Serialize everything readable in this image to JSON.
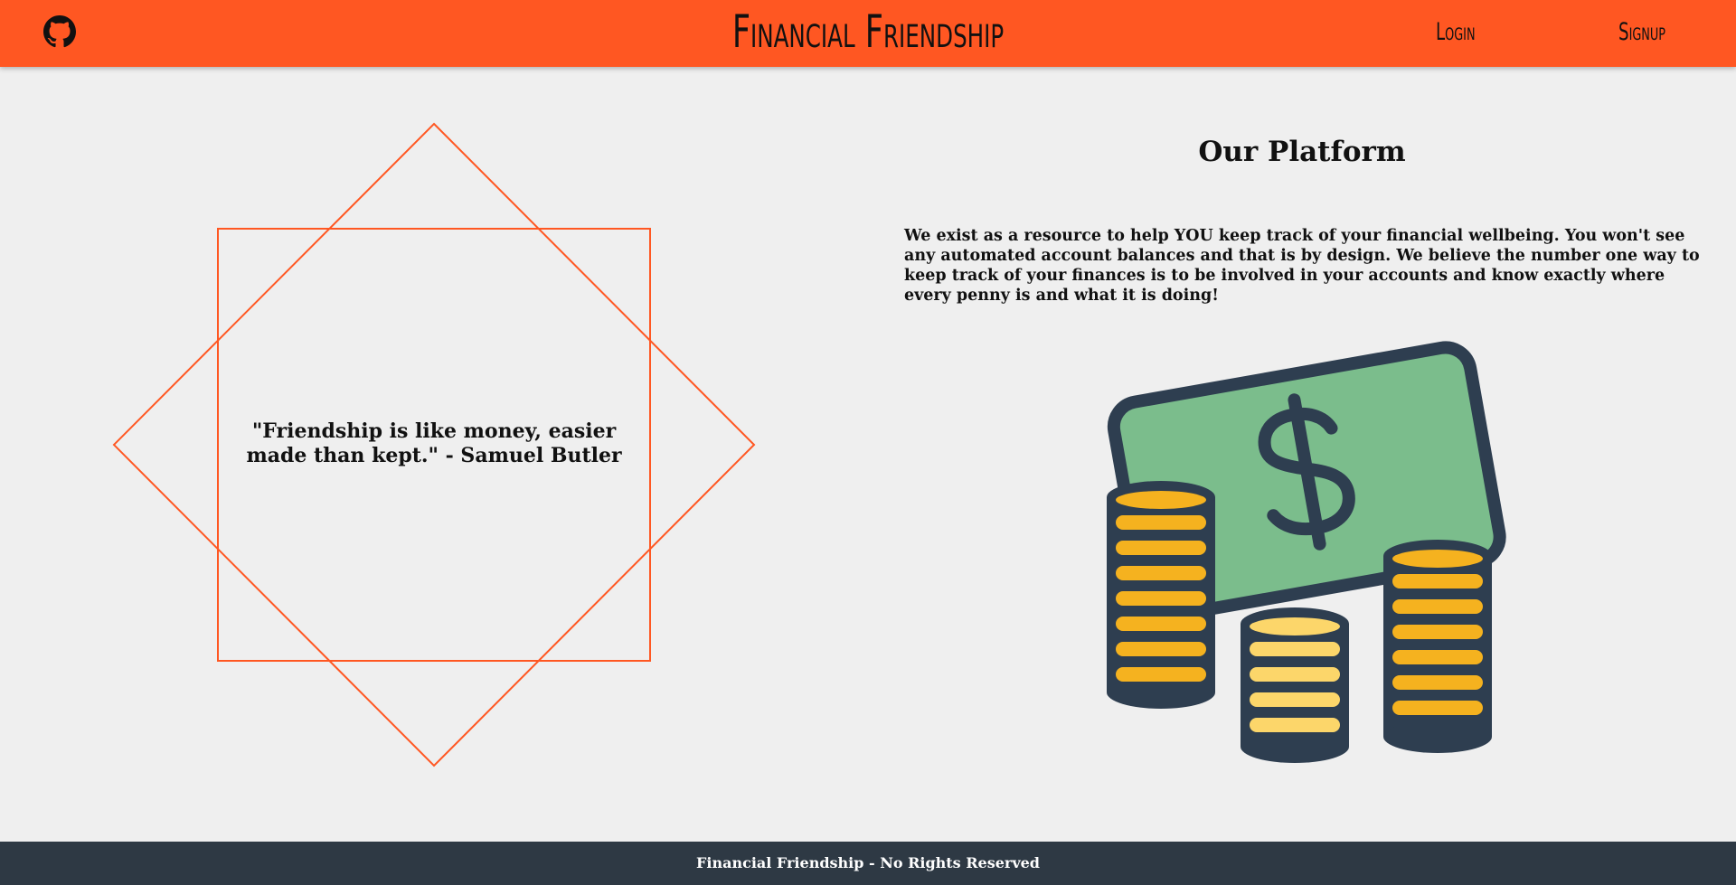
{
  "nav": {
    "brand": "Financial Friendship",
    "github_icon": "github-icon",
    "login_label": "Login",
    "signup_label": "Signup"
  },
  "quote": {
    "text": "\"Friendship is like money, easier made than kept.\" - Samuel Butler"
  },
  "platform": {
    "title": "Our Platform",
    "description": "We exist as a resource to help YOU keep track of your financial wellbeing. You won't see any automated account balances and that is by design. We believe the number one way to keep track of your finances is to be involved in your accounts and know exactly where every penny is and what it is doing!",
    "illustration_icon": "money-coins-icon"
  },
  "footer": {
    "text": "Financial Friendship - No Rights Reserved"
  },
  "colors": {
    "primary": "#ff5722",
    "background": "#efefef",
    "footer": "#2e3944",
    "bill": "#7bbd8c",
    "coin": "#f5b21f",
    "coin_light": "#fcd66a",
    "outline": "#2e3e50"
  }
}
